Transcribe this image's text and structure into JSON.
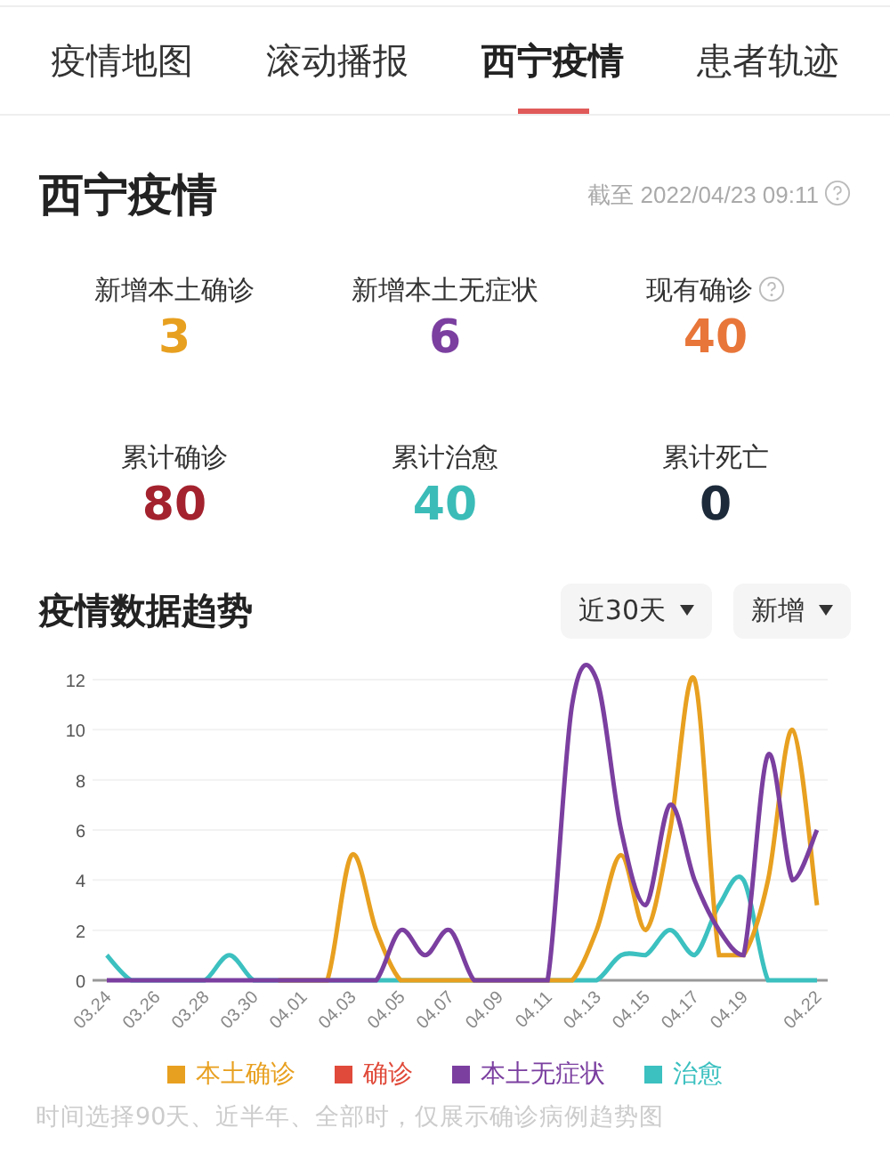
{
  "tabs": [
    {
      "label": "疫情地图",
      "selected": false
    },
    {
      "label": "滚动播报",
      "selected": false
    },
    {
      "label": "西宁疫情",
      "selected": true
    },
    {
      "label": "患者轨迹",
      "selected": false
    }
  ],
  "header": {
    "title": "西宁疫情",
    "updated": "截至 2022/04/23 09:11"
  },
  "stats": [
    {
      "label": "新增本土确诊",
      "value": "3",
      "color": "#e8a020"
    },
    {
      "label": "新增本土无症状",
      "value": "6",
      "color": "#7b3fa0"
    },
    {
      "label": "现有确诊",
      "value": "40",
      "color": "#e8763a",
      "help": true
    },
    {
      "label": "累计确诊",
      "value": "80",
      "color": "#a3222e"
    },
    {
      "label": "累计治愈",
      "value": "40",
      "color": "#3cbcb8"
    },
    {
      "label": "累计死亡",
      "value": "0",
      "color": "#1c2a3a"
    }
  ],
  "trend": {
    "title": "疫情数据趋势",
    "range_select": "近30天",
    "type_select": "新增",
    "chart_data": {
      "type": "line",
      "categories": [
        "03.24",
        null,
        "03.26",
        null,
        "03.28",
        null,
        "03.30",
        null,
        "04.01",
        null,
        "04.03",
        null,
        "04.05",
        null,
        "04.07",
        null,
        "04.09",
        null,
        "04.11",
        null,
        "04.13",
        null,
        "04.15",
        null,
        "04.17",
        null,
        "04.19",
        null,
        null,
        "04.22"
      ],
      "yticks": [
        0,
        2,
        4,
        6,
        8,
        10,
        12
      ],
      "ylim": [
        0,
        12
      ],
      "grid": true,
      "series": [
        {
          "name": "本土确诊",
          "color": "#e8a020",
          "values": [
            null,
            null,
            null,
            null,
            null,
            null,
            null,
            0,
            0,
            0,
            5,
            2,
            0,
            0,
            0,
            0,
            0,
            0,
            0,
            0,
            2,
            5,
            2,
            6,
            12,
            1,
            1,
            4,
            10,
            3
          ]
        },
        {
          "name": "确诊",
          "color": "#e04a3a",
          "values": [
            null,
            null,
            null,
            null,
            null,
            null,
            null,
            null,
            null,
            null,
            null,
            null,
            null,
            null,
            null,
            null,
            null,
            null,
            null,
            null,
            null,
            null,
            null,
            null,
            null,
            null,
            null,
            null,
            null,
            null
          ]
        },
        {
          "name": "本土无症状",
          "color": "#7b3fa0",
          "values": [
            0,
            0,
            0,
            0,
            0,
            0,
            0,
            0,
            0,
            0,
            0,
            0,
            2,
            1,
            2,
            0,
            0,
            0,
            0,
            11,
            12,
            6,
            3,
            7,
            4,
            2,
            1,
            9,
            4,
            6
          ]
        },
        {
          "name": "治愈",
          "color": "#3cc0c0",
          "values": [
            1,
            0,
            0,
            0,
            0,
            1,
            0,
            0,
            0,
            0,
            0,
            0,
            0,
            0,
            0,
            0,
            0,
            0,
            0,
            0,
            0,
            1,
            1,
            2,
            1,
            3,
            4,
            0,
            0,
            0
          ]
        }
      ]
    }
  },
  "note": "时间选择90天、近半年、全部时，仅展示确诊病例趋势图"
}
